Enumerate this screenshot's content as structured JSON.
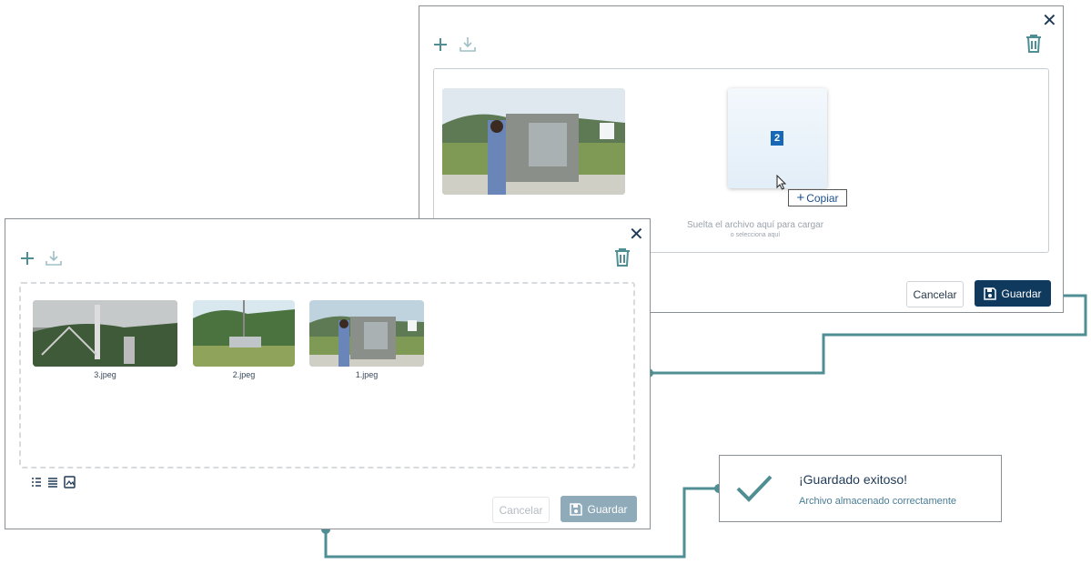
{
  "back_dialog": {
    "close_glyph": "✕",
    "copy_tooltip": "Copiar",
    "drag_badge": "2",
    "drop_hint": "Suelta el archivo aquí para cargar",
    "drop_sub": "o selecciona aquí",
    "cancel_label": "Cancelar",
    "save_label": "Guardar"
  },
  "front_dialog": {
    "close_glyph": "✕",
    "files": [
      {
        "name": "3.jpeg"
      },
      {
        "name": "2.jpeg"
      },
      {
        "name": "1.jpeg"
      }
    ],
    "cancel_label": "Cancelar",
    "save_label": "Guardar"
  },
  "toast": {
    "title": "¡Guardado exitoso!",
    "message": "Archivo almacenado correctamente"
  },
  "colors": {
    "accent_teal": "#4f8f94",
    "primary_navy": "#0f3a5e",
    "disabled_blue": "#8faab9"
  },
  "icons": [
    "plus-icon",
    "download-icon",
    "trash-icon",
    "close-icon",
    "save-icon",
    "check-icon",
    "list-view-icon",
    "detail-view-icon",
    "gallery-view-icon",
    "cursor-icon"
  ]
}
